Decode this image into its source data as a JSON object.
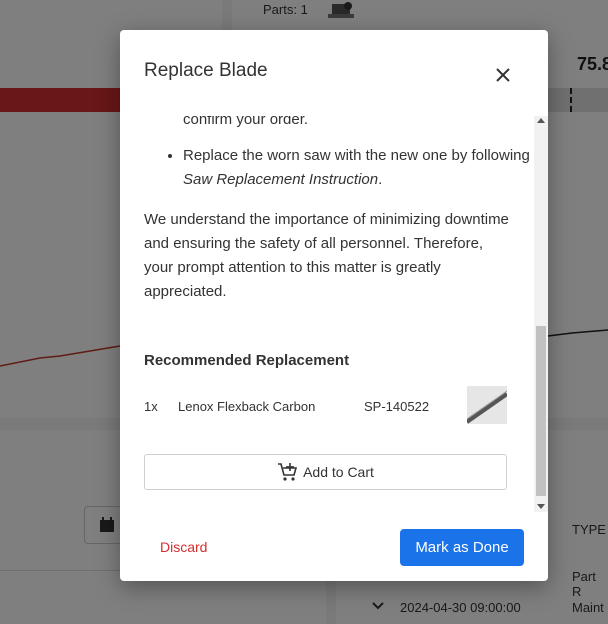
{
  "background": {
    "parts_label": "Parts:  1",
    "metric_value": "75.8",
    "table": {
      "type_header": "TYPE",
      "rows": [
        {
          "date": "",
          "type": "Part R"
        },
        {
          "date": "2024-04-30 09:00:00",
          "type": "Maint"
        }
      ]
    }
  },
  "dialog": {
    "title": "Replace Blade",
    "partial_line": "confirm your order.",
    "steps": [
      "Replace the worn saw with the new one by following the ",
      "Saw Replacement Instruction",
      "."
    ],
    "paragraph": "We understand the importance of minimizing downtime and ensuring the safety of all personnel. Therefore, your prompt attention to this matter is greatly appreciated.",
    "recommended_heading": "Recommended Replacement",
    "item": {
      "qty": "1x",
      "name": "Lenox Flexback Carbon",
      "sku": "SP-140522"
    },
    "add_to_cart": "Add to Cart",
    "discard": "Discard",
    "mark_done": "Mark as Done"
  },
  "colors": {
    "accent": "#1a73e8",
    "danger": "#d32f2f"
  }
}
